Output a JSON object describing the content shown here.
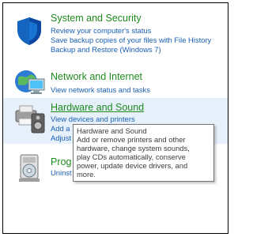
{
  "categories": [
    {
      "title": "System and Security",
      "links": [
        "Review your computer's status",
        "Save backup copies of your files with File History",
        "Backup and Restore (Windows 7)"
      ],
      "icon": "shield-icon"
    },
    {
      "title": "Network and Internet",
      "links": [
        "View network status and tasks"
      ],
      "icon": "network-globe-icon"
    },
    {
      "title": "Hardware and Sound",
      "links": [
        "View devices and printers",
        "Add a",
        "Adjust"
      ],
      "icon": "printer-speaker-icon"
    },
    {
      "title": "Prog",
      "links": [
        "Uninst"
      ],
      "icon": "programs-disc-icon"
    }
  ],
  "tooltip": {
    "title": "Hardware and Sound",
    "body": "Add or remove printers and other\nhardware, change system sounds,\nplay CDs automatically, conserve\npower, update device drivers, and\nmore."
  },
  "colors": {
    "title_green": "#1e8a1e",
    "link_blue": "#1a5fb4",
    "hover_bg": "#e6f1fb"
  }
}
